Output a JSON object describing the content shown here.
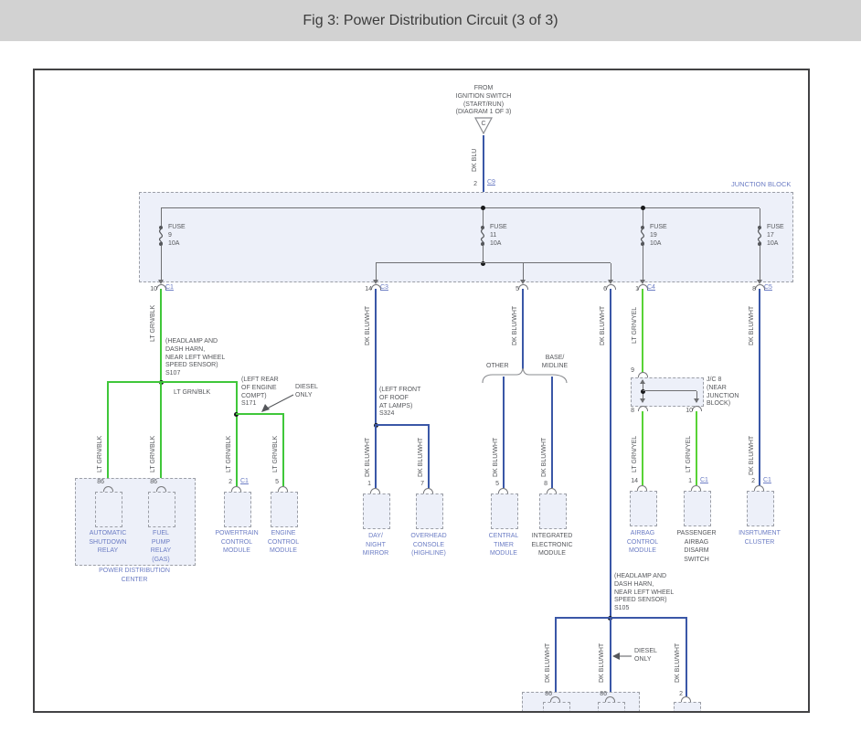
{
  "title": "Fig 3: Power Distribution Circuit (3 of 3)",
  "colors": {
    "titlebar_bg": "#d2d2d2",
    "wire_blue": "#3a57a7",
    "wire_green": "#3fc73a",
    "wire_green_yellow": "#58d336",
    "component_label_blue": "#6b7cc4",
    "note_gray": "#55575b",
    "block_fill": "#edf0f9"
  },
  "source": {
    "note": "FROM\nIGNITION SWITCH\n(START/RUN)\n(DIAGRAM 1 OF 3)",
    "connector_letter": "C",
    "wire_label": "DK BLU",
    "pin": "2",
    "conn": "C9"
  },
  "junction_block": {
    "label": "JUNCTION BLOCK",
    "fuses": [
      {
        "label": "FUSE",
        "number": "9",
        "rating": "10A"
      },
      {
        "label": "FUSE",
        "number": "11",
        "rating": "10A"
      },
      {
        "label": "FUSE",
        "number": "19",
        "rating": "10A"
      },
      {
        "label": "FUSE",
        "number": "17",
        "rating": "10A"
      }
    ],
    "outputs": [
      {
        "pin": "10",
        "conn": "C1"
      },
      {
        "pin": "14",
        "conn": "C3"
      },
      {
        "pin": "5",
        "conn": ""
      },
      {
        "pin": "6",
        "conn": ""
      },
      {
        "pin": "1",
        "conn": "C4"
      },
      {
        "pin": "8",
        "conn": "C5"
      }
    ]
  },
  "wires": {
    "lt_grn_blk": "LT GRN/BLK",
    "lt_grn_yel": "LT GRN/YEL",
    "dk_blu_wht": "DK BLU/WHT"
  },
  "splices": {
    "s107_note": "(HEADLAMP AND\nDASH HARN,\nNEAR LEFT WHEEL\nSPEED SENSOR)\nS107",
    "s171_note": "(LEFT REAR\nOF ENGINE\nCOMPT)\nS171",
    "s324_note": "(LEFT FRONT\nOF ROOF\nAT LAMPS)\nS324",
    "s105_note": "(HEADLAMP AND\nDASH HARN,\nNEAR LEFT WHEEL\nSPEED SENSOR)\nS105"
  },
  "annotations": {
    "diesel_only": "DIESEL\nONLY",
    "other": "OTHER",
    "base_midline": "BASE/\nMIDLINE",
    "jc8_note": "J/C 8\n(NEAR\nJUNCTION\nBLOCK)",
    "jc8_pin_in": "9",
    "jc8_pin_out_left": "8",
    "jc8_pin_out_right": "10"
  },
  "power_distribution_center": {
    "label": "POWER DISTRIBUTION\nCENTER"
  },
  "components": [
    {
      "pin": "86",
      "conn": "",
      "name": "AUTOMATIC\nSHUTDOWN\nRELAY"
    },
    {
      "pin": "86",
      "conn": "",
      "name": "FUEL\nPUMP\nRELAY\n(GAS)"
    },
    {
      "pin": "2",
      "conn": "C1",
      "name": "POWERTRAIN\nCONTROL\nMODULE"
    },
    {
      "pin": "5",
      "conn": "",
      "name": "ENGINE\nCONTROL\nMODULE"
    },
    {
      "pin": "1",
      "conn": "",
      "name": "DAY/\nNIGHT\nMIRROR"
    },
    {
      "pin": "7",
      "conn": "",
      "name": "OVERHEAD\nCONSOLE\n(HIGHLINE)"
    },
    {
      "pin": "5",
      "conn": "",
      "name": "CENTRAL\nTIMER\nMODULE"
    },
    {
      "pin": "8",
      "conn": "",
      "name": "INTEGRATED\nELECTRONIC\nMODULE"
    },
    {
      "pin": "14",
      "conn": "",
      "name": "AIRBAG\nCONTROL\nMODULE"
    },
    {
      "pin": "1",
      "conn": "C1",
      "name": "PASSENGER\nAIRBAG\nDISARM\nSWITCH"
    },
    {
      "pin": "2",
      "conn": "C1",
      "name": "INSRTUMENT\nCLUSTER"
    }
  ],
  "bottom_pins": [
    {
      "pin": "86"
    },
    {
      "pin": "86"
    },
    {
      "pin": "2"
    }
  ]
}
